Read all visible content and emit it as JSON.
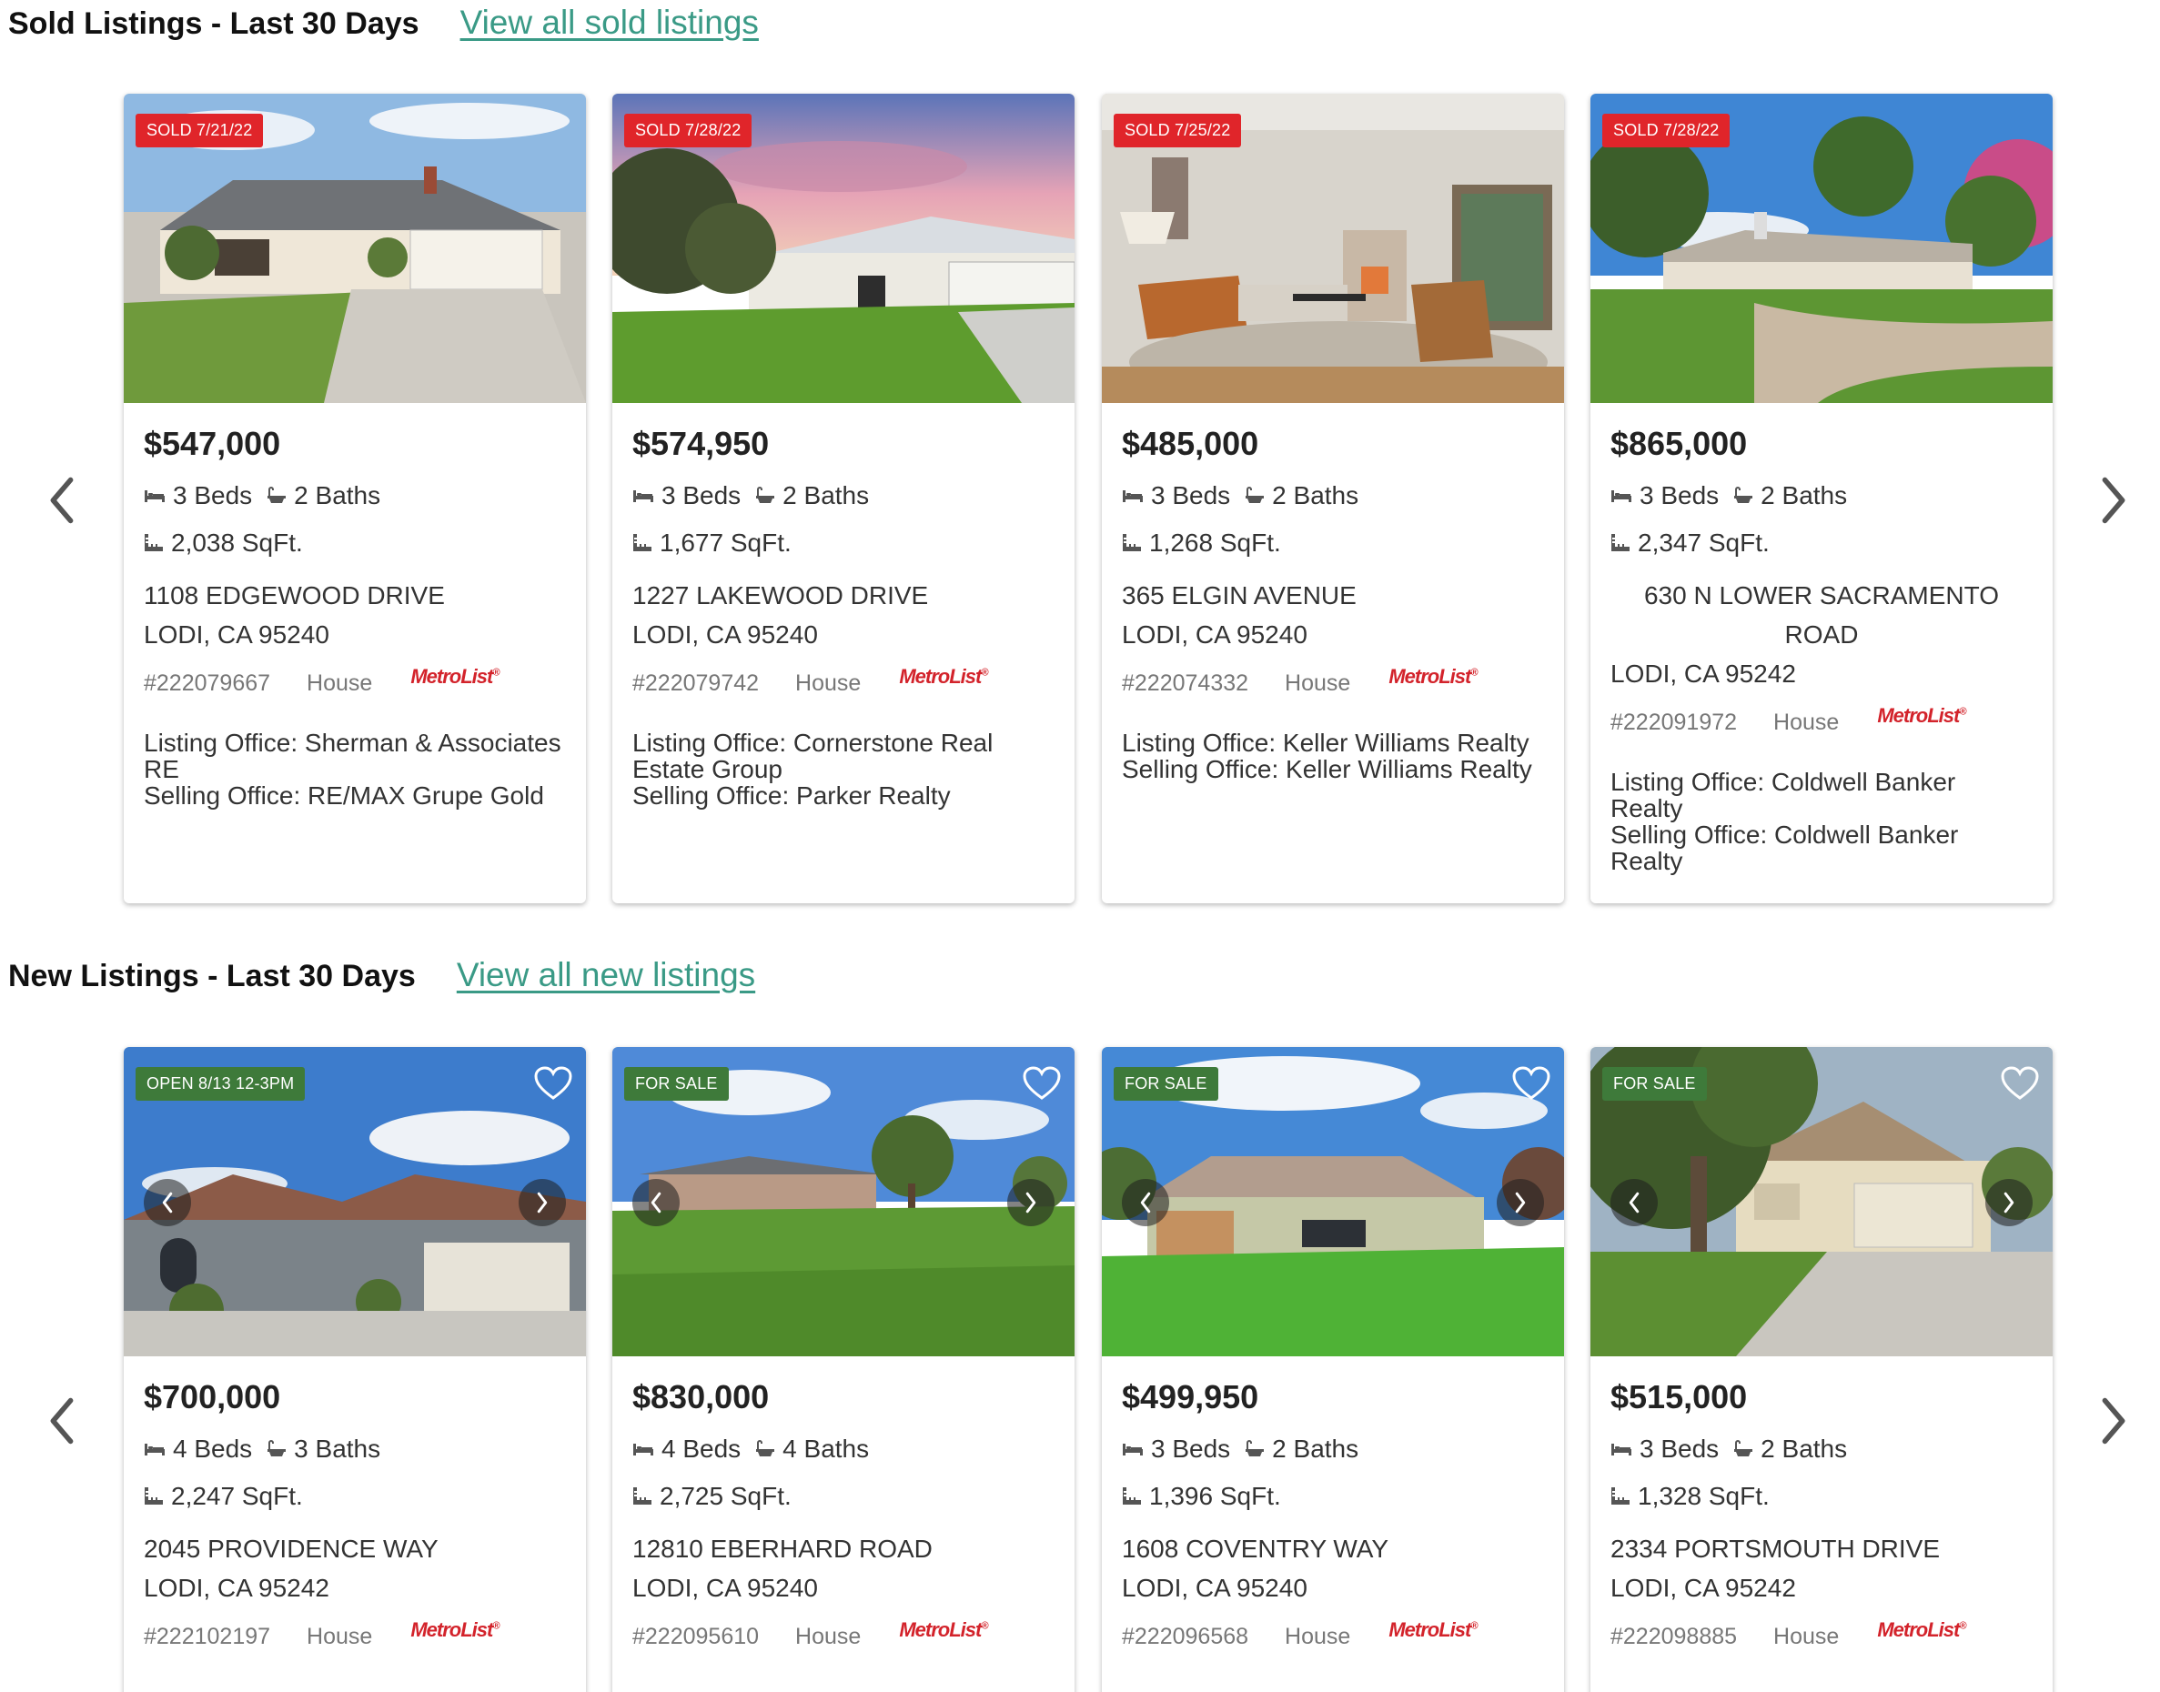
{
  "sold": {
    "title": "Sold Listings - Last 30 Days",
    "link": "View all sold listings",
    "cards": [
      {
        "badge": "SOLD 7/21/22",
        "price": "$547,000",
        "beds": "3 Beds",
        "baths": "2 Baths",
        "sqft": "2,038 SqFt.",
        "addr1": "1108 EDGEWOOD DRIVE",
        "addr2": "LODI, CA 95240",
        "mls": "#222079667",
        "type": "House",
        "brand": "MetroList",
        "listing": "Listing Office: Sherman & Associates RE",
        "selling": "Selling Office: RE/MAX Grupe Gold"
      },
      {
        "badge": "SOLD 7/28/22",
        "price": "$574,950",
        "beds": "3 Beds",
        "baths": "2 Baths",
        "sqft": "1,677 SqFt.",
        "addr1": "1227 LAKEWOOD DRIVE",
        "addr2": "LODI, CA 95240",
        "mls": "#222079742",
        "type": "House",
        "brand": "MetroList",
        "listing": "Listing Office: Cornerstone Real Estate Group",
        "selling": "Selling Office: Parker Realty"
      },
      {
        "badge": "SOLD 7/25/22",
        "price": "$485,000",
        "beds": "3 Beds",
        "baths": "2 Baths",
        "sqft": "1,268 SqFt.",
        "addr1": "365 ELGIN AVENUE",
        "addr2": "LODI, CA 95240",
        "mls": "#222074332",
        "type": "House",
        "brand": "MetroList",
        "listing": "Listing Office: Keller Williams Realty",
        "selling": "Selling Office: Keller Williams Realty"
      },
      {
        "badge": "SOLD 7/28/22",
        "price": "$865,000",
        "beds": "3 Beds",
        "baths": "2 Baths",
        "sqft": "2,347 SqFt.",
        "addr1": "630 N LOWER SACRAMENTO ROAD",
        "addr2": "LODI, CA 95242",
        "mls": "#222091972",
        "type": "House",
        "brand": "MetroList",
        "listing": "Listing Office: Coldwell Banker Realty",
        "selling": "Selling Office: Coldwell Banker Realty"
      }
    ]
  },
  "new": {
    "title": "New Listings - Last 30 Days",
    "link": "View all new listings",
    "cards": [
      {
        "badge": "OPEN 8/13 12-3PM",
        "price": "$700,000",
        "beds": "4 Beds",
        "baths": "3 Baths",
        "sqft": "2,247 SqFt.",
        "addr1": "2045 PROVIDENCE WAY",
        "addr2": "LODI, CA 95242",
        "mls": "#222102197",
        "type": "House",
        "brand": "MetroList"
      },
      {
        "badge": "FOR SALE",
        "price": "$830,000",
        "beds": "4 Beds",
        "baths": "4 Baths",
        "sqft": "2,725 SqFt.",
        "addr1": "12810 EBERHARD ROAD",
        "addr2": "LODI, CA 95240",
        "mls": "#222095610",
        "type": "House",
        "brand": "MetroList"
      },
      {
        "badge": "FOR SALE",
        "price": "$499,950",
        "beds": "3 Beds",
        "baths": "2 Baths",
        "sqft": "1,396 SqFt.",
        "addr1": "1608 COVENTRY WAY",
        "addr2": "LODI, CA 95240",
        "mls": "#222096568",
        "type": "House",
        "brand": "MetroList"
      },
      {
        "badge": "FOR SALE",
        "price": "$515,000",
        "beds": "3 Beds",
        "baths": "2 Baths",
        "sqft": "1,328 SqFt.",
        "addr1": "2334 PORTSMOUTH DRIVE",
        "addr2": "LODI, CA 95242",
        "mls": "#222098885",
        "type": "House",
        "brand": "MetroList"
      }
    ]
  },
  "icons": {
    "prev": "chevron-left-icon",
    "next": "chevron-right-icon",
    "bed": "bed-icon",
    "bath": "bath-icon",
    "sqft": "ruler-icon",
    "favorite": "heart-icon"
  },
  "colors": {
    "link": "#3a9a86",
    "sold_badge": "#e0252a",
    "sale_badge": "#3e7a3a",
    "brand": "#d3232b"
  }
}
